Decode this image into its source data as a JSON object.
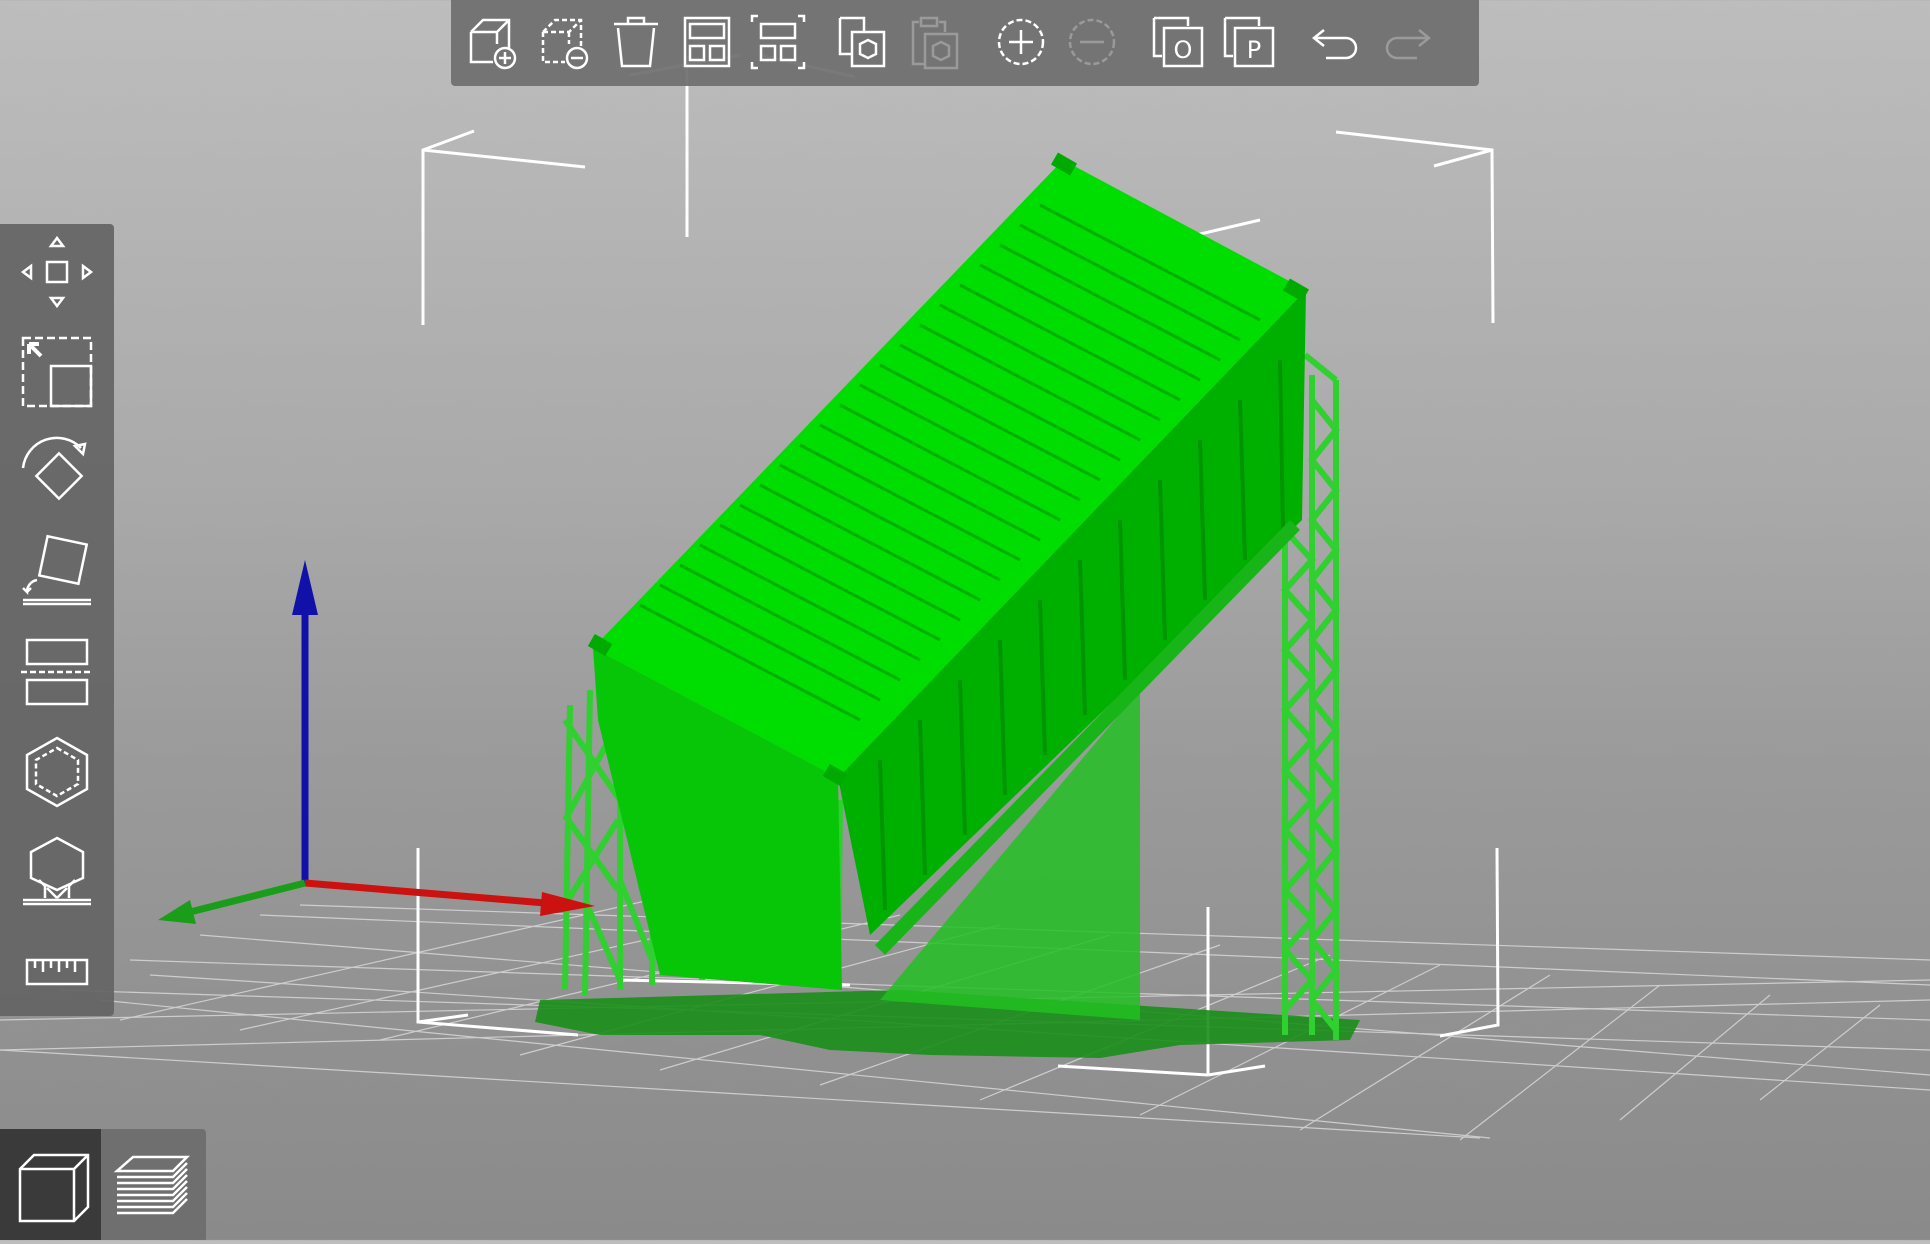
{
  "toolbar": {
    "buttons": [
      {
        "name": "add-icon"
      },
      {
        "name": "delete-icon"
      },
      {
        "name": "delete-all-icon"
      },
      {
        "name": "arrange-icon"
      },
      {
        "name": "arrange-selection-icon"
      },
      {
        "name": "copy-icon"
      },
      {
        "name": "paste-icon",
        "disabled": true
      },
      {
        "name": "add-instance-icon"
      },
      {
        "name": "remove-instance-icon",
        "disabled": true
      },
      {
        "name": "split-to-objects-icon",
        "glyph": "O"
      },
      {
        "name": "split-to-parts-icon",
        "glyph": "P"
      },
      {
        "name": "undo-icon"
      },
      {
        "name": "redo-icon",
        "disabled": true
      }
    ]
  },
  "sidebar": {
    "tools": [
      {
        "name": "move-icon"
      },
      {
        "name": "scale-icon"
      },
      {
        "name": "rotate-icon"
      },
      {
        "name": "place-on-face-icon"
      },
      {
        "name": "cut-icon"
      },
      {
        "name": "hollow-icon"
      },
      {
        "name": "support-points-icon"
      },
      {
        "name": "measure-icon"
      }
    ]
  },
  "viewbar": {
    "views": [
      {
        "name": "3d-view-icon",
        "active": true
      },
      {
        "name": "preview-layers-icon",
        "active": false
      }
    ]
  },
  "colors": {
    "model": "#00d000",
    "model_dark": "#00a800",
    "supports": "#22cc22",
    "axis_x": "#cc1111",
    "axis_y": "#1a9e1a",
    "axis_z": "#1111aa",
    "toolbar_bg": "#6e6e6e",
    "icon_stroke": "#ffffff",
    "icon_disabled": "#9a9a9a"
  }
}
